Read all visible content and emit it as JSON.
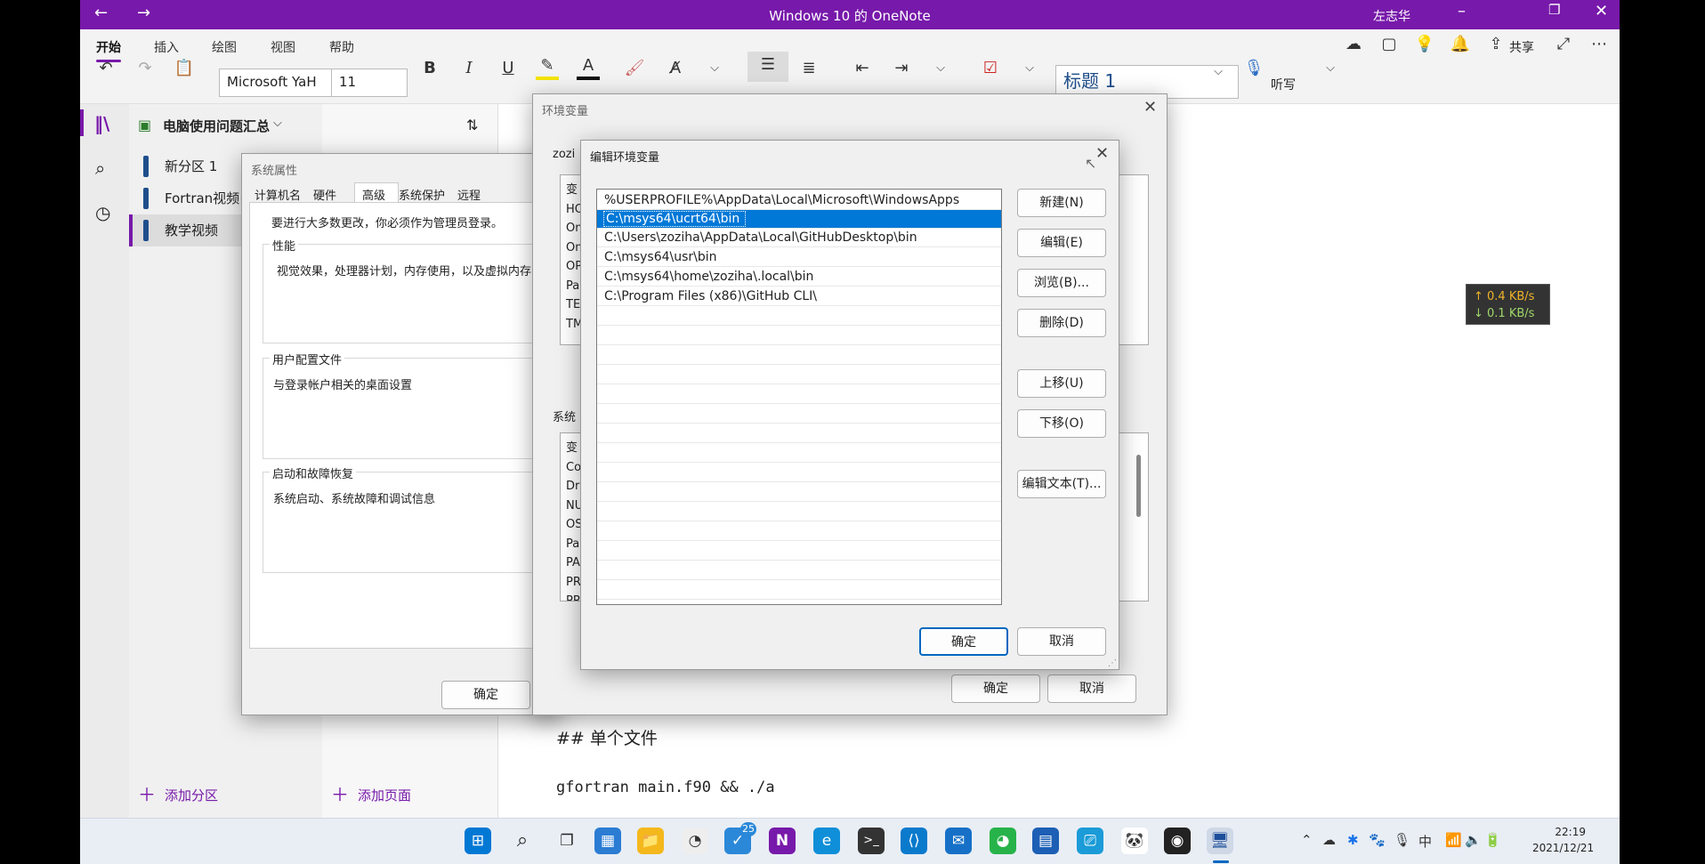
{
  "window": {
    "title": "Windows 10 的 OneNote",
    "user": "左志华"
  },
  "ribbon": {
    "tabs": [
      "开始",
      "插入",
      "绘图",
      "视图",
      "帮助"
    ],
    "font_name": "Microsoft YaH",
    "font_size": "11",
    "style": "标题 1",
    "share": "共享",
    "dictate": "听写"
  },
  "notebook": {
    "name": "电脑使用问题汇总",
    "sections": [
      "新分区 1",
      "Fortran视频",
      "教学视频"
    ],
    "add_section": "添加分区",
    "add_page": "添加页面"
  },
  "note": {
    "heading": "## 单个文件",
    "code": "gfortran main.f90 && ./a"
  },
  "sysprops": {
    "title": "系统属性",
    "tabs": [
      "计算机名",
      "硬件",
      "高级",
      "系统保护",
      "远程"
    ],
    "admin_note": "要进行大多数更改，你必须作为管理员登录。",
    "perf_label": "性能",
    "perf_desc": "视觉效果，处理器计划，内存使用，以及虚拟内存",
    "profile_label": "用户配置文件",
    "profile_desc": "与登录帐户相关的桌面设置",
    "startup_label": "启动和故障恢复",
    "startup_desc": "系统启动、系统故障和调试信息",
    "ok": "确定"
  },
  "envvars": {
    "title": "环境变量",
    "user_label": "zozi",
    "user_rows": [
      "变",
      "HO",
      "On",
      "On",
      "OP",
      "Pa",
      "TE",
      "TM"
    ],
    "sys_label": "系统",
    "sys_rows": [
      "变",
      "Co",
      "Dr",
      "NU",
      "OS",
      "Pa",
      "PA",
      "PR",
      "PR"
    ],
    "ok": "确定",
    "cancel": "取消"
  },
  "editenv": {
    "title": "编辑环境变量",
    "paths": [
      "%USERPROFILE%\\AppData\\Local\\Microsoft\\WindowsApps",
      "C:\\msys64\\ucrt64\\bin",
      "C:\\Users\\zoziha\\AppData\\Local\\GitHubDesktop\\bin",
      "C:\\msys64\\usr\\bin",
      "C:\\msys64\\home\\zoziha\\.local\\bin",
      "C:\\Program Files (x86)\\GitHub CLI\\"
    ],
    "buttons": {
      "new": "新建(N)",
      "edit": "编辑(E)",
      "browse": "浏览(B)...",
      "delete": "删除(D)",
      "up": "上移(U)",
      "down": "下移(O)",
      "edit_text": "编辑文本(T)..."
    },
    "ok": "确定",
    "cancel": "取消"
  },
  "netspeed": {
    "up": "↑ 0.4 KB/s",
    "down": "↓ 0.1 KB/s"
  },
  "taskbar": {
    "badge": "25",
    "ime": "中",
    "time": "22:19",
    "date": "2021/12/21"
  }
}
